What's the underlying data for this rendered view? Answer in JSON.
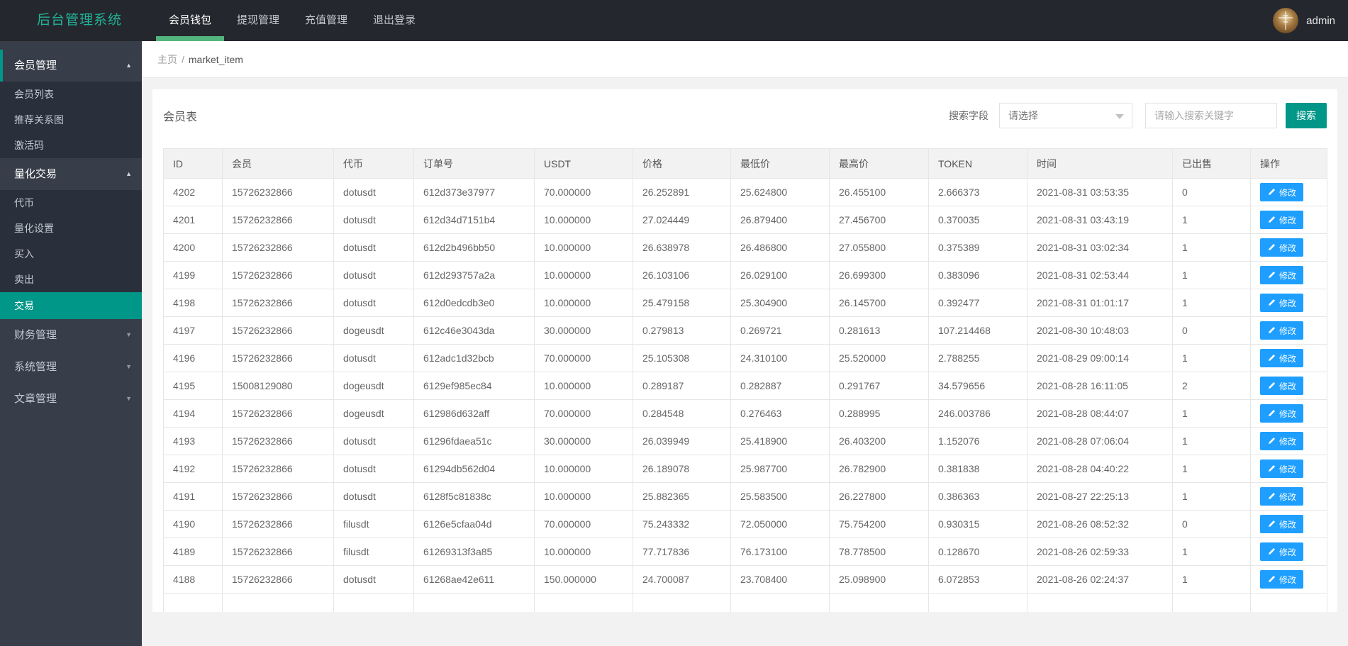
{
  "app": {
    "title": "后台管理系统",
    "user": "admin"
  },
  "navbar": {
    "tabs": [
      {
        "label": "会员钱包",
        "active": true
      },
      {
        "label": "提现管理",
        "active": false
      },
      {
        "label": "充值管理",
        "active": false
      },
      {
        "label": "退出登录",
        "active": false
      }
    ]
  },
  "icons": {
    "chevron_up": "▲",
    "chevron_down": "▼"
  },
  "sidebar": {
    "items": [
      {
        "label": "会员管理",
        "type": "section",
        "state": "expanded"
      },
      {
        "label": "会员列表",
        "type": "item"
      },
      {
        "label": "推荐关系图",
        "type": "item"
      },
      {
        "label": "激活码",
        "type": "item"
      },
      {
        "label": "量化交易",
        "type": "section",
        "state": "expanded"
      },
      {
        "label": "代币",
        "type": "item"
      },
      {
        "label": "量化设置",
        "type": "item"
      },
      {
        "label": "买入",
        "type": "item"
      },
      {
        "label": "卖出",
        "type": "item"
      },
      {
        "label": "交易",
        "type": "item",
        "active": true
      },
      {
        "label": "财务管理",
        "type": "section",
        "state": "collapsed"
      },
      {
        "label": "系统管理",
        "type": "section",
        "state": "collapsed"
      },
      {
        "label": "文章管理",
        "type": "section",
        "state": "collapsed"
      }
    ]
  },
  "breadcrumb": {
    "home": "主页",
    "separator": "/",
    "current": "market_item"
  },
  "panel": {
    "title": "会员表",
    "search": {
      "field_label": "搜索字段",
      "select_value": "请选择",
      "input_placeholder": "请输入搜索关键字",
      "button_label": "搜索"
    }
  },
  "table": {
    "columns": [
      "ID",
      "会员",
      "代币",
      "订单号",
      "USDT",
      "价格",
      "最低价",
      "最高价",
      "TOKEN",
      "时间",
      "已出售",
      "操作"
    ],
    "edit_label": "修改",
    "rows": [
      [
        "4202",
        "15726232866",
        "dotusdt",
        "612d373e37977",
        "70.000000",
        "26.252891",
        "25.624800",
        "26.455100",
        "2.666373",
        "2021-08-31 03:53:35",
        "0"
      ],
      [
        "4201",
        "15726232866",
        "dotusdt",
        "612d34d7151b4",
        "10.000000",
        "27.024449",
        "26.879400",
        "27.456700",
        "0.370035",
        "2021-08-31 03:43:19",
        "1"
      ],
      [
        "4200",
        "15726232866",
        "dotusdt",
        "612d2b496bb50",
        "10.000000",
        "26.638978",
        "26.486800",
        "27.055800",
        "0.375389",
        "2021-08-31 03:02:34",
        "1"
      ],
      [
        "4199",
        "15726232866",
        "dotusdt",
        "612d293757a2a",
        "10.000000",
        "26.103106",
        "26.029100",
        "26.699300",
        "0.383096",
        "2021-08-31 02:53:44",
        "1"
      ],
      [
        "4198",
        "15726232866",
        "dotusdt",
        "612d0edcdb3e0",
        "10.000000",
        "25.479158",
        "25.304900",
        "26.145700",
        "0.392477",
        "2021-08-31 01:01:17",
        "1"
      ],
      [
        "4197",
        "15726232866",
        "dogeusdt",
        "612c46e3043da",
        "30.000000",
        "0.279813",
        "0.269721",
        "0.281613",
        "107.214468",
        "2021-08-30 10:48:03",
        "0"
      ],
      [
        "4196",
        "15726232866",
        "dotusdt",
        "612adc1d32bcb",
        "70.000000",
        "25.105308",
        "24.310100",
        "25.520000",
        "2.788255",
        "2021-08-29 09:00:14",
        "1"
      ],
      [
        "4195",
        "15008129080",
        "dogeusdt",
        "6129ef985ec84",
        "10.000000",
        "0.289187",
        "0.282887",
        "0.291767",
        "34.579656",
        "2021-08-28 16:11:05",
        "2"
      ],
      [
        "4194",
        "15726232866",
        "dogeusdt",
        "612986d632aff",
        "70.000000",
        "0.284548",
        "0.276463",
        "0.288995",
        "246.003786",
        "2021-08-28 08:44:07",
        "1"
      ],
      [
        "4193",
        "15726232866",
        "dotusdt",
        "61296fdaea51c",
        "30.000000",
        "26.039949",
        "25.418900",
        "26.403200",
        "1.152076",
        "2021-08-28 07:06:04",
        "1"
      ],
      [
        "4192",
        "15726232866",
        "dotusdt",
        "61294db562d04",
        "10.000000",
        "26.189078",
        "25.987700",
        "26.782900",
        "0.381838",
        "2021-08-28 04:40:22",
        "1"
      ],
      [
        "4191",
        "15726232866",
        "dotusdt",
        "6128f5c81838c",
        "10.000000",
        "25.882365",
        "25.583500",
        "26.227800",
        "0.386363",
        "2021-08-27 22:25:13",
        "1"
      ],
      [
        "4190",
        "15726232866",
        "filusdt",
        "6126e5cfaa04d",
        "70.000000",
        "75.243332",
        "72.050000",
        "75.754200",
        "0.930315",
        "2021-08-26 08:52:32",
        "0"
      ],
      [
        "4189",
        "15726232866",
        "filusdt",
        "61269313f3a85",
        "10.000000",
        "77.717836",
        "76.173100",
        "78.778500",
        "0.128670",
        "2021-08-26 02:59:33",
        "1"
      ],
      [
        "4188",
        "15726232866",
        "dotusdt",
        "61268ae42e611",
        "150.000000",
        "24.700087",
        "23.708400",
        "25.098900",
        "6.072853",
        "2021-08-26 02:24:37",
        "1"
      ]
    ]
  },
  "colors": {
    "accent_teal": "#009688",
    "nav_underline_green": "#54b47e",
    "logo_green": "#22b397",
    "edit_button_blue": "#1E9FFF",
    "navbar_bg": "#24272d",
    "sidebar_bg": "#373d49",
    "sidebar_sub_bg": "#2a303b",
    "table_border": "#e6e6e6"
  }
}
